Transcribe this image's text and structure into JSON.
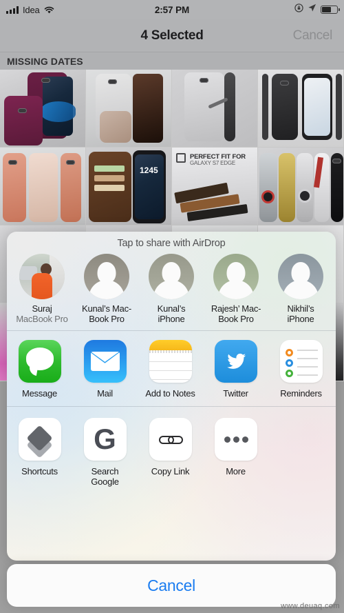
{
  "status_bar": {
    "carrier": "Idea",
    "signal_icon": "signal-bars-icon",
    "wifi_icon": "wifi-icon",
    "time": "2:57 PM",
    "rotation_lock_icon": "rotation-lock-icon",
    "location_icon": "location-arrow-icon",
    "battery_icon": "battery-icon",
    "battery_level": 62
  },
  "nav_bar": {
    "title": "4 Selected",
    "cancel_label": "Cancel"
  },
  "photos": {
    "section_header": "MISSING DATES",
    "thumbnails": [
      {
        "alt": "purple phone case pair"
      },
      {
        "alt": "silver kickstand case"
      },
      {
        "alt": "clear bumper case"
      },
      {
        "alt": "black case with screen"
      },
      {
        "alt": "rose gold case trio"
      },
      {
        "alt": "brown wallet folio case"
      },
      {
        "alt": "perfect fit for galaxy s7 edge"
      },
      {
        "alt": "printed car design cases"
      }
    ],
    "badge_title": "PERFECT FIT FOR",
    "badge_subtitle": "GALAXY S7 EDGE"
  },
  "share_sheet": {
    "airdrop": {
      "header": "Tap to share with AirDrop",
      "contacts": [
        {
          "name": "Suraj",
          "device": "MacBook Pro",
          "avatar": "photo"
        },
        {
          "name": "Kunal’s Mac-",
          "name2": "Book Pro",
          "device": "",
          "avatar": "silhouette"
        },
        {
          "name": "Kunal’s",
          "name2": "iPhone",
          "device": "",
          "avatar": "silhouette"
        },
        {
          "name": "Rajesh’ Mac-",
          "name2": "Book Pro",
          "device": "",
          "avatar": "silhouette"
        },
        {
          "name": "Nikhil’s",
          "name2": "iPhone",
          "device": "",
          "avatar": "silhouette"
        }
      ]
    },
    "apps": [
      {
        "label": "Message",
        "icon": "message-icon"
      },
      {
        "label": "Mail",
        "icon": "mail-icon"
      },
      {
        "label": "Add to Notes",
        "icon": "notes-icon"
      },
      {
        "label": "Twitter",
        "icon": "twitter-icon"
      },
      {
        "label": "Reminders",
        "icon": "reminders-icon"
      }
    ],
    "actions": [
      {
        "label": "Shortcuts",
        "icon": "shortcuts-icon"
      },
      {
        "label": "Search",
        "label2": "Google",
        "icon": "google-icon"
      },
      {
        "label": "Copy Link",
        "icon": "link-icon"
      },
      {
        "label": "More",
        "icon": "ellipsis-icon"
      }
    ],
    "cancel_label": "Cancel"
  },
  "watermark": "www.deuaq.com",
  "colors": {
    "accent_blue": "#1a7cf0",
    "message_green": "#2ebb2e",
    "mail_blue": "#2b9ff0",
    "notes_yellow": "#ffcd29",
    "twitter_blue": "#1d8ddb",
    "nav_bg": "#b2b3b5"
  }
}
